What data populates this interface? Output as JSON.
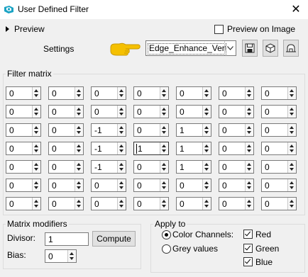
{
  "window": {
    "title": "User Defined Filter",
    "close_glyph": "✕"
  },
  "top_bar": {
    "preview_label": "Preview",
    "preview_on_image_label": "Preview on Image",
    "preview_on_image_checked": false
  },
  "settings": {
    "label": "Settings",
    "preset_value": "Edge_Enhance_Vert...",
    "buttons": [
      "save-icon",
      "cube-icon",
      "reset-icon"
    ],
    "hint_icon": "pointing-hand-icon"
  },
  "matrix": {
    "label": "Filter matrix",
    "rows": [
      [
        "0",
        "0",
        "0",
        "0",
        "0",
        "0",
        "0"
      ],
      [
        "0",
        "0",
        "0",
        "0",
        "0",
        "0",
        "0"
      ],
      [
        "0",
        "0",
        "-1",
        "0",
        "1",
        "0",
        "0"
      ],
      [
        "0",
        "0",
        "-1",
        "1",
        "1",
        "0",
        "0"
      ],
      [
        "0",
        "0",
        "-1",
        "0",
        "1",
        "0",
        "0"
      ],
      [
        "0",
        "0",
        "0",
        "0",
        "0",
        "0",
        "0"
      ],
      [
        "0",
        "0",
        "0",
        "0",
        "0",
        "0",
        "0"
      ]
    ],
    "focused_cell": [
      3,
      3
    ]
  },
  "modifiers": {
    "label": "Matrix modifiers",
    "divisor_label": "Divisor:",
    "divisor_value": "1",
    "compute_label": "Compute",
    "bias_label": "Bias:",
    "bias_value": "0"
  },
  "apply_to": {
    "label": "Apply to",
    "color_channels_label": "Color Channels:",
    "grey_values_label": "Grey values",
    "selected": "color_channels",
    "channels": [
      {
        "label": "Red",
        "checked": true
      },
      {
        "label": "Green",
        "checked": true
      },
      {
        "label": "Blue",
        "checked": true
      }
    ]
  },
  "colors": {
    "window_bg": "#f0f0f0",
    "title_bg": "#ffffff",
    "app_icon": "#1aa3c4",
    "hand_icon": "#f5c000"
  }
}
